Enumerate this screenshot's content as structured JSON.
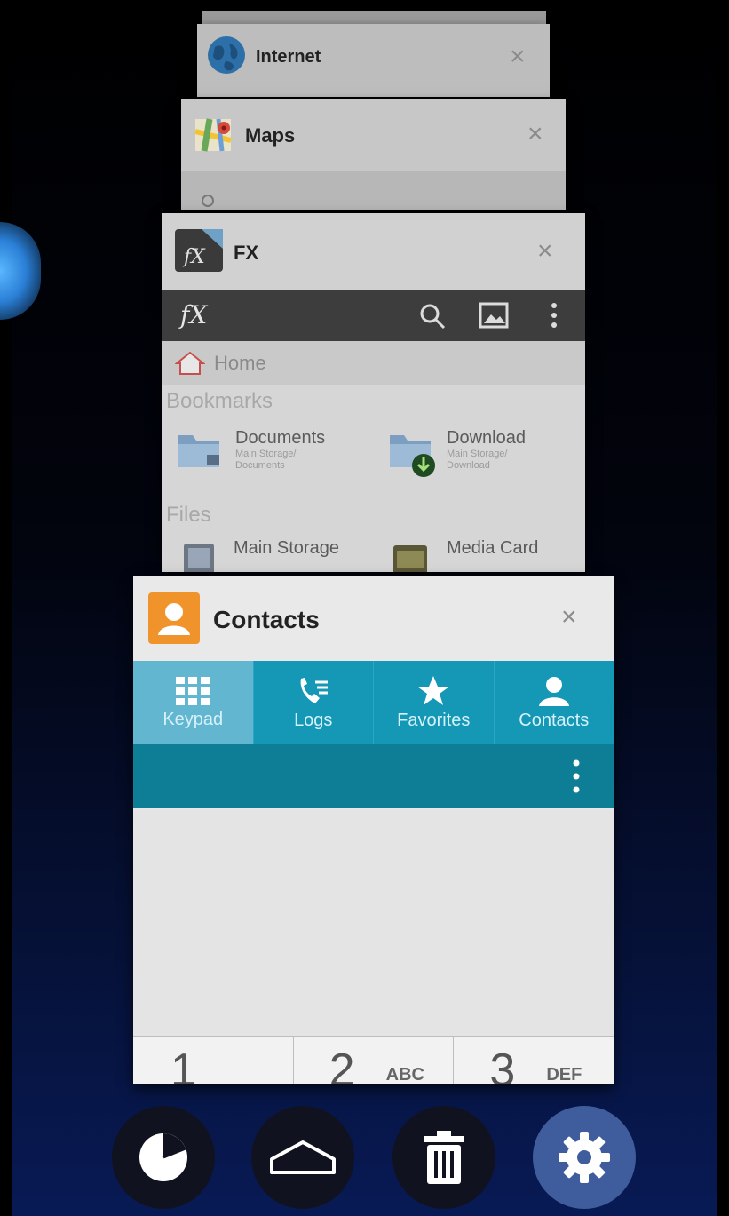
{
  "recent_apps": [
    {
      "name": "Internet"
    },
    {
      "name": "Maps"
    },
    {
      "name": "FX",
      "home_label": "Home",
      "bookmarks_header": "Bookmarks",
      "files_header": "Files",
      "bookmarks": [
        {
          "name": "Documents",
          "sub": "Main Storage/ Documents"
        },
        {
          "name": "Download",
          "sub": "Main Storage/ Download"
        }
      ],
      "files": [
        {
          "name": "Main Storage"
        },
        {
          "name": "Media Card"
        }
      ]
    },
    {
      "name": "Contacts",
      "tabs": [
        {
          "label": "Keypad",
          "icon": "keypad-icon",
          "active": true
        },
        {
          "label": "Logs",
          "icon": "call-log-icon",
          "active": false
        },
        {
          "label": "Favorites",
          "icon": "star-icon",
          "active": false
        },
        {
          "label": "Contacts",
          "icon": "person-icon",
          "active": false
        }
      ],
      "keys": [
        {
          "num": "1",
          "letters": ""
        },
        {
          "num": "2",
          "letters": "ABC"
        },
        {
          "num": "3",
          "letters": "DEF"
        }
      ]
    }
  ],
  "bottom_bar": [
    {
      "name": "memory-manager-icon"
    },
    {
      "name": "home-icon"
    },
    {
      "name": "trash-icon"
    },
    {
      "name": "settings-icon"
    }
  ],
  "colors": {
    "contacts_tab_bar": "#1597b6",
    "contacts_action_bar": "#0e7d96",
    "settings_button": "#3f5d9c"
  }
}
